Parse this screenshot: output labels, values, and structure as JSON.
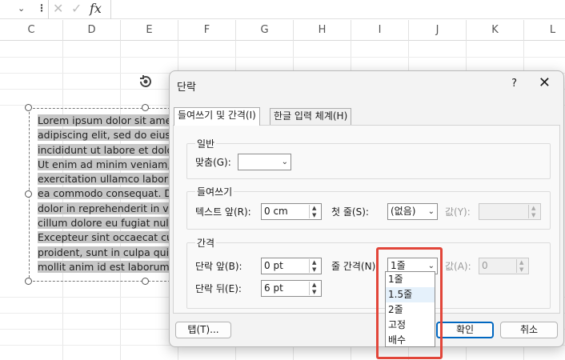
{
  "formula_bar": {
    "fx": "fx"
  },
  "columns": [
    "C",
    "D",
    "E",
    "F",
    "G",
    "H",
    "I",
    "J",
    "K",
    "L"
  ],
  "textbox": {
    "lines": [
      "Lorem ipsum dolor sit amet",
      "adipiscing elit, sed do eiusm",
      "incididunt ut labore et dolo",
      "Ut enim ad minim veniam, q",
      "exercitation ullamco laboris",
      "ea commodo consequat. Du",
      "dolor in reprehenderit in vo",
      "cillum dolore eu fugiat nulla",
      "Excepteur sint occaecat cup",
      "proident, sunt in culpa qui o",
      "mollit anim id est laborum."
    ]
  },
  "dialog": {
    "title": "단락",
    "help": "?",
    "close": "✕",
    "tabs": [
      {
        "label": "들여쓰기 및 간격(I)",
        "active": true
      },
      {
        "label": "한글 입력 체계(H)",
        "active": false
      }
    ],
    "general": {
      "group_label": "일반",
      "alignment_label": "맞춤(G):",
      "alignment_value": ""
    },
    "indent": {
      "group_label": "들여쓰기",
      "before_text_label": "텍스트 앞(R):",
      "before_text_value": "0 cm",
      "first_line_label": "첫 줄(S):",
      "first_line_value": "(없음)",
      "by_label": "값(Y):",
      "by_value": ""
    },
    "spacing": {
      "group_label": "간격",
      "before_label": "단락 앞(B):",
      "before_value": "0 pt",
      "after_label": "단락 뒤(E):",
      "after_value": "6 pt",
      "line_spacing_label": "줄 간격(N)",
      "line_spacing_value": "1줄",
      "at_label": "값(A):",
      "at_value": "0"
    },
    "line_spacing_options": [
      "1줄",
      "1.5줄",
      "2줄",
      "고정",
      "배수"
    ],
    "hovered_option_index": 1,
    "buttons": {
      "tabs": "탭(T)...",
      "ok": "확인",
      "cancel": "취소"
    },
    "highlight_color": "#e2463a"
  }
}
